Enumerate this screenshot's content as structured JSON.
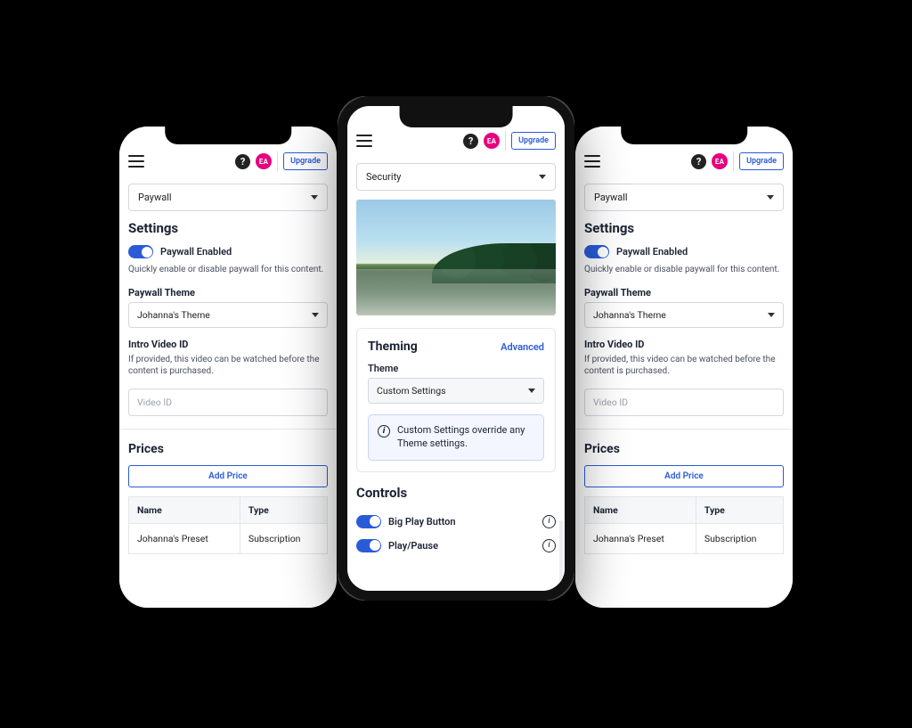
{
  "header": {
    "avatar_initials": "EA",
    "upgrade_label": "Upgrade"
  },
  "side_screen": {
    "dropdown_value": "Paywall",
    "settings_title": "Settings",
    "paywall_toggle_label": "Paywall Enabled",
    "paywall_toggle_desc": "Quickly enable or disable paywall for this content.",
    "theme_label": "Paywall Theme",
    "theme_value": "Johanna's Theme",
    "intro_label": "Intro Video ID",
    "intro_desc": "If provided, this video can be watched before the content is purchased.",
    "intro_placeholder": "Video ID",
    "prices_title": "Prices",
    "add_price_label": "Add Price",
    "price_cols": {
      "name": "Name",
      "type": "Type"
    },
    "price_rows": [
      {
        "name": "Johanna's Preset",
        "type": "Subscription"
      }
    ]
  },
  "center_screen": {
    "dropdown_value": "Security",
    "theming": {
      "title": "Theming",
      "advanced_link": "Advanced",
      "field_label": "Theme",
      "field_value": "Custom Settings",
      "info_text": "Custom Settings override any Theme settings."
    },
    "controls": {
      "title": "Controls",
      "items": [
        {
          "label": "Big Play Button"
        },
        {
          "label": "Play/Pause"
        }
      ]
    }
  }
}
